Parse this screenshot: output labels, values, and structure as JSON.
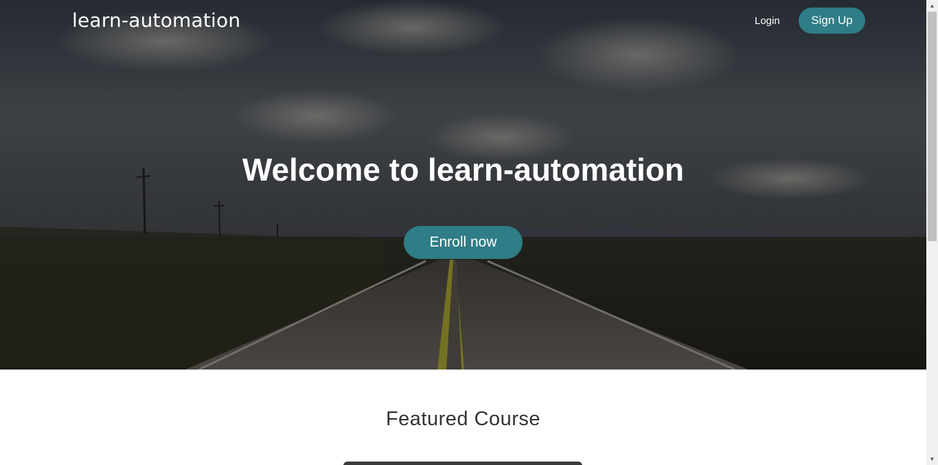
{
  "header": {
    "brand": "learn-automation",
    "login_label": "Login",
    "signup_label": "Sign Up"
  },
  "hero": {
    "title": "Welcome to learn-automation",
    "cta_label": "Enroll now",
    "background_image": "road-landscape-image"
  },
  "featured": {
    "title": "Featured Course"
  },
  "colors": {
    "accent": "#2f7d86",
    "text_dark": "#333333"
  },
  "scrollbar": {
    "up_icon": "scroll-up-arrow-icon",
    "down_icon": "scroll-down-arrow-icon"
  }
}
